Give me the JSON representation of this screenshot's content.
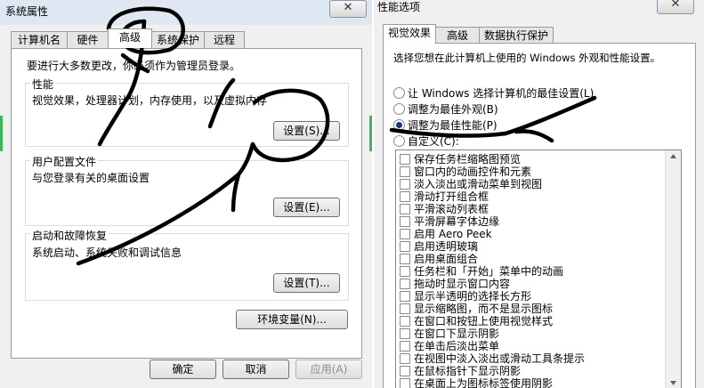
{
  "left_window": {
    "title": "系统属性",
    "close_label": "✕",
    "tabs": [
      {
        "label": "计算机名"
      },
      {
        "label": "硬件"
      },
      {
        "label": "高级"
      },
      {
        "label": "系统保护"
      },
      {
        "label": "远程"
      }
    ],
    "admin_note": "要进行大多数更改，你必须作为管理员登录。",
    "performance": {
      "label": "性能",
      "desc": "视觉效果，处理器计划，内存使用，以及虚拟内存",
      "button": "设置(S)..."
    },
    "user_profiles": {
      "label": "用户配置文件",
      "desc": "与您登录有关的桌面设置",
      "button": "设置(E)..."
    },
    "startup": {
      "label": "启动和故障恢复",
      "desc": "系统启动、系统失败和调试信息",
      "button": "设置(T)..."
    },
    "env_button": "环境变量(N)...",
    "ok": "确定",
    "cancel": "取消",
    "apply": "应用(A)"
  },
  "right_window": {
    "title": "性能选项",
    "close_label": "✕",
    "tabs": [
      {
        "label": "视觉效果"
      },
      {
        "label": "高级"
      },
      {
        "label": "数据执行保护"
      }
    ],
    "intro": "选择您想在此计算机上使用的 Windows 外观和性能设置。",
    "options": [
      {
        "label": "让 Windows 选择计算机的最佳设置(L)",
        "checked": false
      },
      {
        "label": "调整为最佳外观(B)",
        "checked": false
      },
      {
        "label": "调整为最佳性能(P)",
        "checked": true
      },
      {
        "label": "自定义(C):",
        "checked": false
      }
    ],
    "effects": [
      "保存任务栏缩略图预览",
      "窗口内的动画控件和元素",
      "淡入淡出或滑动菜单到视图",
      "滑动打开组合框",
      "平滑滚动列表框",
      "平滑屏幕字体边缘",
      "启用 Aero Peek",
      "启用透明玻璃",
      "启用桌面组合",
      "任务栏和「开始」菜单中的动画",
      "拖动时显示窗口内容",
      "显示半透明的选择长方形",
      "显示缩略图，而不是显示图标",
      "在窗口和按钮上使用视觉样式",
      "在窗口下显示阴影",
      "在单击后淡出菜单",
      "在视图中淡入淡出或滑动工具条提示",
      "在鼠标指针下显示阴影",
      "在桌面上为图标标签使用阴影"
    ]
  },
  "colors": {
    "accent_strip": "#3cb85c",
    "titlebar": "#dfe8f2"
  }
}
